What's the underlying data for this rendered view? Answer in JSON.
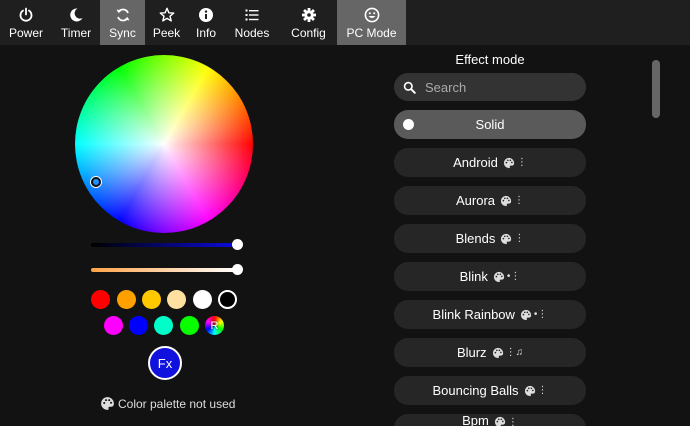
{
  "nav": {
    "tabs": [
      {
        "label": "Power",
        "icon": "power-icon"
      },
      {
        "label": "Timer",
        "icon": "moon-icon"
      },
      {
        "label": "Sync",
        "icon": "sync-icon",
        "active": true
      },
      {
        "label": "Peek",
        "icon": "star-icon"
      },
      {
        "label": "Info",
        "icon": "info-icon"
      },
      {
        "label": "Nodes",
        "icon": "list-icon"
      },
      {
        "label": "Config",
        "icon": "gear-icon"
      },
      {
        "label": "PC Mode",
        "icon": "smiley-icon",
        "active": true
      }
    ]
  },
  "color": {
    "brightness_level": 1.0,
    "temperature_level": 1.0,
    "swatches_row1": [
      "#ff0000",
      "#ffa000",
      "#ffc800",
      "#ffe0a0",
      "#ffffff",
      "#000000"
    ],
    "swatches_row2": [
      "#ff00ff",
      "#0000ff",
      "#00ffc8",
      "#08ff00",
      "rainbow"
    ],
    "rainbow_label": "R",
    "fx_label": "Fx",
    "palette_note": "Color palette not used"
  },
  "effects": {
    "title": "Effect mode",
    "search_placeholder": "Search",
    "items": [
      {
        "name": "Solid",
        "selected": true,
        "flags": ""
      },
      {
        "name": "Android",
        "flags": "⋮"
      },
      {
        "name": "Aurora",
        "flags": "⋮"
      },
      {
        "name": "Blends",
        "flags": "⋮"
      },
      {
        "name": "Blink",
        "flags": "•⋮"
      },
      {
        "name": "Blink Rainbow",
        "flags": "•⋮"
      },
      {
        "name": "Blurz",
        "flags": "⋮♫"
      },
      {
        "name": "Bouncing Balls",
        "flags": "⋮"
      },
      {
        "name": "Bpm",
        "flags": "⋮"
      }
    ]
  },
  "colors": {
    "accent": "#1111dd",
    "background": "#121212",
    "nav_background": "#1f1f1f",
    "nav_active": "#666666",
    "item_background": "#262626",
    "item_selected": "#5a5a5a"
  }
}
